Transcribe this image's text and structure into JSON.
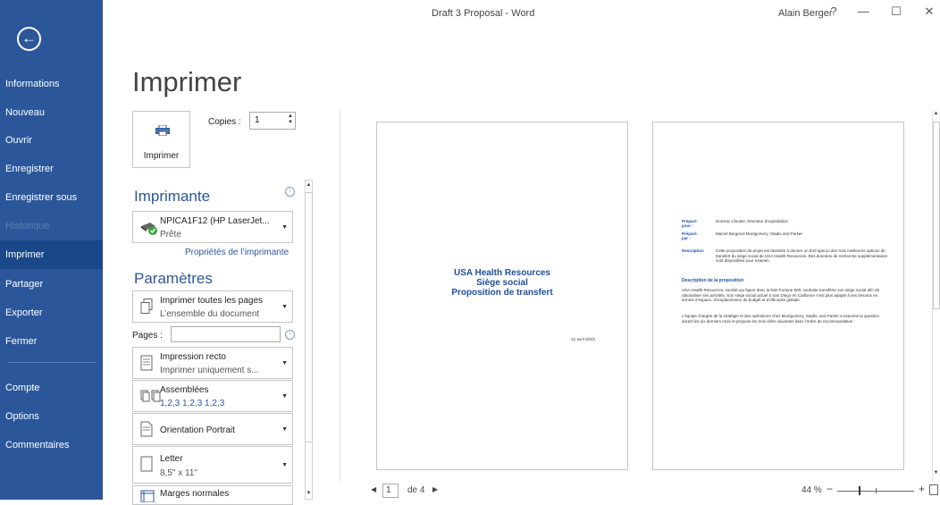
{
  "window": {
    "title": "Draft 3 Proposal - Word",
    "user": "Alain Berger",
    "help_glyph": "?",
    "minimize_glyph": "—",
    "maximize_glyph": "☐",
    "close_glyph": "✕"
  },
  "sidebar": {
    "back_glyph": "←",
    "items": [
      {
        "label": "Informations"
      },
      {
        "label": "Nouveau"
      },
      {
        "label": "Ouvrir"
      },
      {
        "label": "Enregistrer"
      },
      {
        "label": "Enregistrer sous"
      },
      {
        "label": "Historique",
        "disabled": true
      },
      {
        "label": "Imprimer",
        "active": true
      },
      {
        "label": "Partager"
      },
      {
        "label": "Exporter"
      },
      {
        "label": "Fermer"
      },
      {
        "label": "Compte"
      },
      {
        "label": "Options"
      },
      {
        "label": "Commentaires"
      }
    ]
  },
  "print": {
    "page_title": "Imprimer",
    "button_label": "Imprimer",
    "copies_label": "Copies :",
    "copies_value": "1"
  },
  "printer": {
    "heading": "Imprimante",
    "name": "NPICA1F12 (HP LaserJet...",
    "status": "Prête",
    "properties_link": "Propriétés de l’imprimante"
  },
  "settings": {
    "heading": "Paramètres",
    "print_what": {
      "line1": "Imprimer toutes les pages",
      "line2": "L’ensemble du document"
    },
    "pages_label": "Pages :",
    "sides": {
      "line1": "Impression recto",
      "line2": "Imprimer uniquement s..."
    },
    "collate": {
      "line1": "Assemblées",
      "line2": "1,2,3   1,2,3   1,2,3"
    },
    "orientation": {
      "line1": "Orientation Portrait"
    },
    "paper": {
      "line1": "Letter",
      "line2": "8,5\" x 11\""
    },
    "margins": {
      "line1": "Marges normales"
    }
  },
  "preview": {
    "page1": {
      "title_lines": [
        "USA Health Resources",
        "Siège social",
        "Proposition de transfert"
      ],
      "date": "21 avril 20XX"
    },
    "page2": {
      "prepared_for_label": "Préparé pour :",
      "prepared_for_value": "Dominic Cloutier, Directeur d’exploitation",
      "prepared_by_label": "Préparé par :",
      "prepared_by_value": "Marcel Bergevol Montgomery, Stadlo and Parker",
      "description_label": "Description :",
      "description_value": "Cette proposition de projet est destinée à donner un bref aperçu des trois meilleures options de transfert du siège social de USA Health Resources. Des données de recherche supplémentaires sont disponibles pour examen.",
      "section_heading": "Description de la proposition",
      "paragraph1": "USA Health Resources, société qui figure dans la liste Fortune 500, souhaite transférer son siège social afin de rationaliser ses activités. Son siège social actuel à San Diego en Californie n’est plus adapté à ses besoins en termes d’espace, d’emplacement, de budget et d’efficacité globale.",
      "paragraph2": "L’équipe chargée de la stratégie et des opérations chez Montgomery, Stadlo, and Parker a examiné la question durant les six derniers mois et propose les trois villes suivantes dans l’ordre de recommandation :"
    }
  },
  "status": {
    "current_page": "1",
    "page_of": "de 4",
    "zoom": "44 %",
    "zoom_minus": "−",
    "zoom_plus": "+"
  }
}
